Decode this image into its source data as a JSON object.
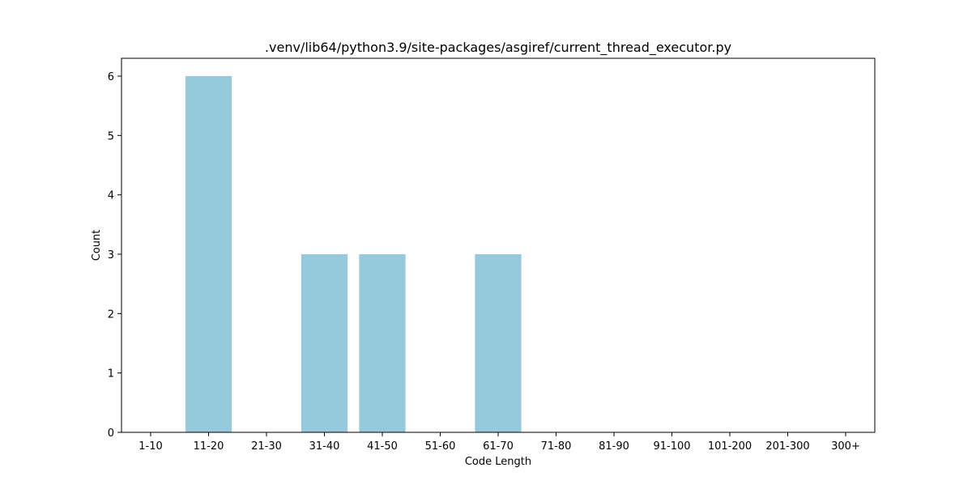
{
  "chart_data": {
    "type": "bar",
    "title": ".venv/lib64/python3.9/site-packages/asgiref/current_thread_executor.py",
    "xlabel": "Code Length",
    "ylabel": "Count",
    "categories": [
      "1-10",
      "11-20",
      "21-30",
      "31-40",
      "41-50",
      "51-60",
      "61-70",
      "71-80",
      "81-90",
      "91-100",
      "101-200",
      "201-300",
      "300+"
    ],
    "values": [
      0,
      6,
      0,
      3,
      3,
      0,
      3,
      0,
      0,
      0,
      0,
      0,
      0
    ],
    "yticks": [
      0,
      1,
      2,
      3,
      4,
      5,
      6
    ],
    "ylim": [
      0,
      6.3
    ],
    "grid": false,
    "bar_color": "#96c9dc"
  }
}
